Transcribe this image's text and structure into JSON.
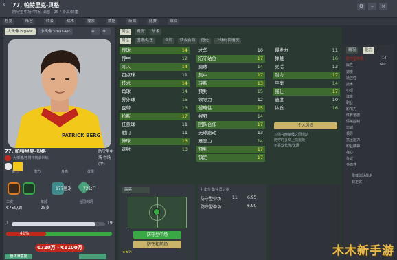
{
  "window": {
    "title": "77. 帕特里克-贝格",
    "subtitle": "防守型中场 中场, 法国 | 25 / 身高/体重"
  },
  "nav": [
    "总览",
    "阵容",
    "转会",
    "战术",
    "搜索",
    "数据",
    "新闻",
    "比赛",
    "球探"
  ],
  "left": {
    "tabs": [
      "大头像 Big-Pic",
      "小头像 Small-Pic"
    ],
    "photo_text": "PATRICK BERG",
    "player_name": "77. 帕特里克-贝格",
    "player_sub": "为博德/格林特转会训练",
    "position_lines": [
      "防守型中",
      "场 中场",
      "(中)"
    ],
    "stats": [
      {
        "label": "能力",
        "value": ""
      },
      {
        "label": "潜力",
        "value": ""
      },
      {
        "label": "身高",
        "value": "177厘米"
      },
      {
        "label": "体重",
        "value": "72公斤"
      }
    ],
    "contract": [
      {
        "label": "工资",
        "value": "€750/周"
      },
      {
        "label": "年龄",
        "value": "25岁"
      },
      {
        "label": "合同到期",
        "value": ""
      },
      {
        "label": "",
        "value": ""
      }
    ],
    "bar_a": {
      "left": "1",
      "right": "19",
      "fill": 0.9
    },
    "pct": {
      "left": "41%",
      "right": ""
    },
    "value_range": "€720万 - €1100万",
    "bottom_tabs": [
      "整体满意度",
      ""
    ]
  },
  "center": {
    "tabs": [
      "属性",
      "概况",
      "战术"
    ],
    "subtabs": [
      "属性",
      "国籍/队伍",
      "合同",
      "转会合同",
      "历史",
      "上场时间情况"
    ],
    "technical": [
      {
        "label": "传球",
        "value": "14",
        "hl": true
      },
      {
        "label": "传中",
        "value": "12"
      },
      {
        "label": "盯人",
        "value": "14",
        "hl": true
      },
      {
        "label": "罚点球",
        "value": "11"
      },
      {
        "label": "技术",
        "value": "14",
        "hl": true
      },
      {
        "label": "角球",
        "value": "14"
      },
      {
        "label": "界外球",
        "value": "15"
      },
      {
        "label": "盘带",
        "value": "13"
      },
      {
        "label": "抢断",
        "value": "17",
        "hl": true
      },
      {
        "label": "任意球",
        "value": "11"
      },
      {
        "label": "射门",
        "value": "11"
      },
      {
        "label": "停球",
        "value": "13",
        "hl": true
      },
      {
        "label": "远射",
        "value": "13"
      }
    ],
    "mental": [
      {
        "label": "才华",
        "value": "10"
      },
      {
        "label": "防守站位",
        "value": "17",
        "hl": true
      },
      {
        "label": "勇敢",
        "value": "14"
      },
      {
        "label": "集中",
        "value": "17",
        "hl": true
      },
      {
        "label": "决断",
        "value": "13",
        "hl": true
      },
      {
        "label": "预判",
        "value": "15"
      },
      {
        "label": "领导力",
        "value": "12"
      },
      {
        "label": "侵略性",
        "value": "15",
        "hl": true
      },
      {
        "label": "视野",
        "value": "14"
      },
      {
        "label": "团队合作",
        "value": "17",
        "hl": true
      },
      {
        "label": "无球跑动",
        "value": "13"
      },
      {
        "label": "意志力",
        "value": "14"
      },
      {
        "label": "预判",
        "value": "17",
        "hl": true
      },
      {
        "label": "镇定",
        "value": "17",
        "hl": true
      }
    ],
    "physical": [
      {
        "label": "爆发力",
        "value": "11"
      },
      {
        "label": "弹跳",
        "value": "16"
      },
      {
        "label": "灵活",
        "value": "13"
      },
      {
        "label": "耐力",
        "value": "17",
        "hl": true
      },
      {
        "label": "平衡",
        "value": "14"
      },
      {
        "label": "强壮",
        "value": "17",
        "hl": true
      },
      {
        "label": "速度",
        "value": "10"
      },
      {
        "label": "体质",
        "value": "16"
      }
    ],
    "personal_button": "个人习惯",
    "habits": [
      "习惯在两条线之间活动",
      "防守时喜欢上前逼抢",
      "不喜欢长传/球场"
    ],
    "bottom": {
      "selector": "高亮",
      "position": "防守型中场",
      "role": "防守和前场",
      "mini_title": "打出位置/生涯之类",
      "mini_rows": [
        {
          "label": "防守型中场",
          "a": "11",
          "b": "6.95"
        },
        {
          "label": "防守型中场",
          "a": "",
          "b": "6.90"
        }
      ]
    }
  },
  "right": {
    "tabs": [
      "概况",
      "能力"
    ],
    "items": [
      "防守型中场",
      "属性",
      "速度",
      "适应性",
      "技术",
      "心理",
      "体能",
      "职业",
      "影响力",
      "体育道德",
      "情绪控制",
      "忠诚",
      "领导",
      "抗压能力",
      "职业精神",
      "雄心",
      "争议",
      "多面性"
    ],
    "numbers": [
      "14",
      "140"
    ],
    "bottom": [
      "重载球队战术",
      "非正式"
    ]
  },
  "watermark": "木木新手游"
}
